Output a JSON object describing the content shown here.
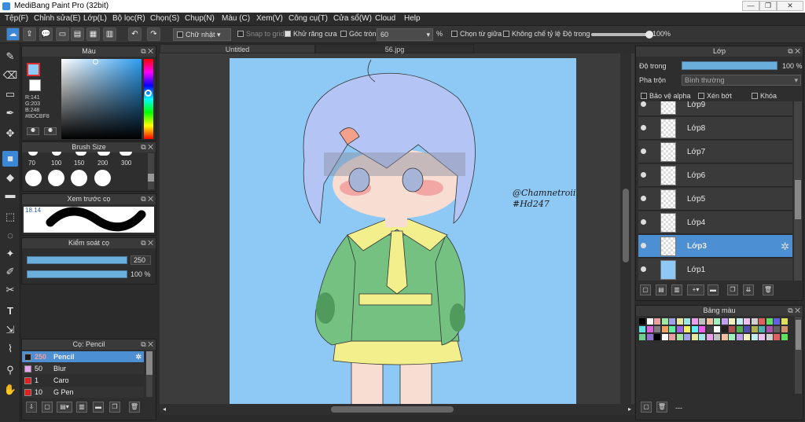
{
  "window": {
    "title": "MediBang Paint Pro (32bit)"
  },
  "menu": [
    "Tệp(F)",
    "Chỉnh sửa(E)",
    "Lớp(L)",
    "Bộ lọc(R)",
    "Chọn(S)",
    "Chụp(N)",
    "Màu (C)",
    "Xem(V)",
    "Công cụ(T)",
    "Cửa sổ(W)",
    "Cloud",
    "Help"
  ],
  "toolbar": {
    "shape": "Chữ nhật",
    "snap": "Snap to grid",
    "antialias": "Khử răng cưa",
    "round_corner": "Góc tròn",
    "round_value": "60",
    "percent": "%",
    "from_center": "Chọn từ giữa",
    "no_ratio": "Không chế tỷ lệ",
    "opacity_label": "Độ trong",
    "opacity_value": "100%",
    "opacity_level": 1.0
  },
  "color_panel": {
    "title": "Màu",
    "r": "R:141",
    "g": "G:203",
    "b": "B:248",
    "hex": "#8DCBF8",
    "fg": "#8DCBF8"
  },
  "brush_size_panel": {
    "title": "Brush Size",
    "sizes": [
      "70",
      "100",
      "150",
      "200",
      "300"
    ]
  },
  "preview_panel": {
    "title": "Xem trước cọ",
    "value": "18.14"
  },
  "brush_control": {
    "title": "Kiểm soát cọ",
    "size": "250",
    "opacity": "100 %"
  },
  "brush_panel": {
    "title": "Cọ: Pencil",
    "brushes": [
      {
        "num": "250",
        "name": "Pencil",
        "color": "#1a1a1a"
      },
      {
        "num": "50",
        "name": "Blur",
        "color": "#e9a6f0"
      },
      {
        "num": "1",
        "name": "Caro",
        "color": "#e02020"
      },
      {
        "num": "10",
        "name": "G Pen",
        "color": "#e02020"
      }
    ]
  },
  "tabs": [
    "Untitled",
    "56.jpg"
  ],
  "canvas": {
    "signature_1": "@Chamnetroiii",
    "signature_2": "#Hd247",
    "background": "#8DCBF8"
  },
  "layer_panel": {
    "title": "Lớp",
    "opacity_label": "Độ trong",
    "opacity_value": "100 %",
    "blend_label": "Pha trộn",
    "blend_value": "Bình thường",
    "protect_alpha": "Bảo vệ alpha",
    "clipping": "Xén bớt",
    "lock": "Khóa",
    "layers": [
      "Lớp9",
      "Lớp8",
      "Lớp7",
      "Lớp6",
      "Lớp5",
      "Lớp4",
      "Lớp3",
      "Lớp1"
    ],
    "selected": "Lớp3"
  },
  "palette_panel": {
    "title": "Bảng màu",
    "footer": "---"
  }
}
